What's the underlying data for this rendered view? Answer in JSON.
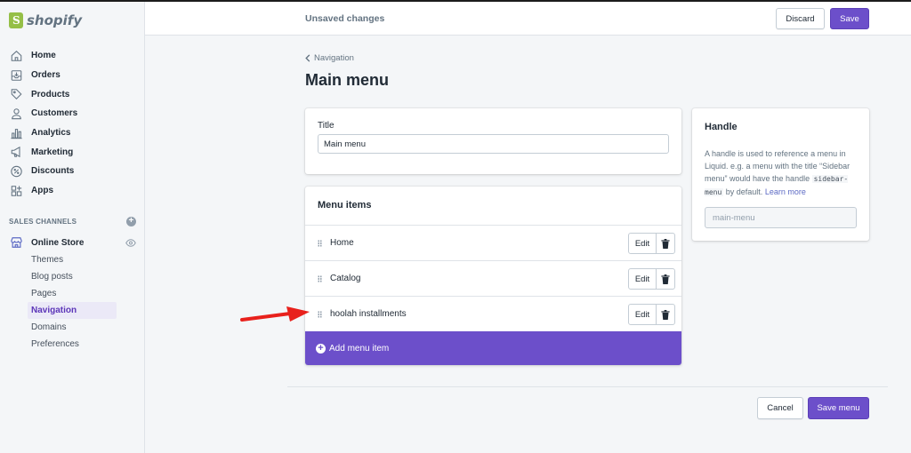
{
  "brand": {
    "name": "shopify"
  },
  "sidebar": {
    "items": [
      {
        "label": "Home",
        "icon": "home-icon"
      },
      {
        "label": "Orders",
        "icon": "orders-icon"
      },
      {
        "label": "Products",
        "icon": "tag-icon"
      },
      {
        "label": "Customers",
        "icon": "person-icon"
      },
      {
        "label": "Analytics",
        "icon": "bar-chart-icon"
      },
      {
        "label": "Marketing",
        "icon": "megaphone-icon"
      },
      {
        "label": "Discounts",
        "icon": "discount-icon"
      },
      {
        "label": "Apps",
        "icon": "apps-icon"
      }
    ],
    "sales_channels_heading": "SALES CHANNELS",
    "online_store_label": "Online Store",
    "online_store_subitems": [
      "Themes",
      "Blog posts",
      "Pages",
      "Navigation",
      "Domains",
      "Preferences"
    ],
    "active_subitem": "Navigation"
  },
  "topbar": {
    "status": "Unsaved changes",
    "discard_label": "Discard",
    "save_label": "Save"
  },
  "main": {
    "breadcrumb": "Navigation",
    "title": "Main menu",
    "title_card": {
      "label": "Title",
      "value": "Main menu"
    },
    "menu_items_card": {
      "heading": "Menu items",
      "rows": [
        {
          "label": "Home",
          "edit_label": "Edit"
        },
        {
          "label": "Catalog",
          "edit_label": "Edit"
        },
        {
          "label": "hoolah installments",
          "edit_label": "Edit"
        }
      ],
      "add_label": "Add menu item"
    },
    "handle_card": {
      "heading": "Handle",
      "desc_prefix": "A handle is used to reference a menu in Liquid. e.g. a menu with the title “Sidebar menu” would have the handle",
      "desc_code": "sidebar-menu",
      "desc_suffix": "by default.",
      "learn_more": "Learn more",
      "placeholder": "main-menu"
    },
    "footer": {
      "cancel_label": "Cancel",
      "save_menu_label": "Save menu"
    }
  },
  "colors": {
    "primary": "#6c4fca",
    "annotation_arrow": "#e8211c",
    "brand_green": "#95bf47"
  }
}
